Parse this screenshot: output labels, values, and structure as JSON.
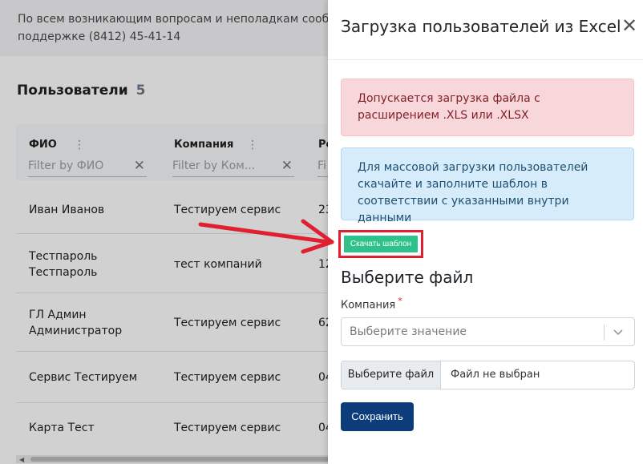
{
  "notice": {
    "line1": "По всем возникающим вопросам и неполадкам сообщайте",
    "line2": "поддержке (8412) 45-41-14"
  },
  "page": {
    "title": "Пользователи",
    "count": "5"
  },
  "table": {
    "columns": [
      {
        "header": "ФИО",
        "filter_placeholder": "Filter by ФИО"
      },
      {
        "header": "Компания",
        "filter_placeholder": "Filter by Ком..."
      },
      {
        "header": "Ро",
        "filter_placeholder": "Fi"
      }
    ],
    "rows": [
      {
        "name_l1": "Иван Иванов",
        "name_l2": "",
        "company": "Тестируем сервис",
        "extra": "23"
      },
      {
        "name_l1": "Тестпароль",
        "name_l2": "Тестпароль",
        "company": "тест компаний",
        "extra": "12"
      },
      {
        "name_l1": "ГЛ Админ",
        "name_l2": "Администратор",
        "company": "Тестируем сервис",
        "extra": "62"
      },
      {
        "name_l1": "Сервис Тестируем",
        "name_l2": "",
        "company": "Тестируем сервис",
        "extra": "04"
      },
      {
        "name_l1": "Карта Тест",
        "name_l2": "",
        "company": "Тестируем сервис",
        "extra": "04"
      }
    ]
  },
  "drawer": {
    "title": "Загрузка пользователей из Excel",
    "close_symbol": "✕",
    "alert_danger": "Допускается загрузка файла с расширением .XLS или .XLSX",
    "alert_info": "Для массовой загрузки пользователей скачайте и заполните шаблон в соответствии с указанными внутри данными",
    "download_label": "Скачать шаблон",
    "section_title": "Выберите файл",
    "company_label": "Компания",
    "required_mark": "*",
    "select_placeholder": "Выберите значение",
    "file_button": "Выберите файл",
    "file_status": "Файл не выбран",
    "save_label": "Сохранить"
  },
  "colors": {
    "download_button": "#2fc18c",
    "highlight_frame": "#e02030",
    "save_button": "#0c3d7a",
    "arrow": "#e02030"
  }
}
